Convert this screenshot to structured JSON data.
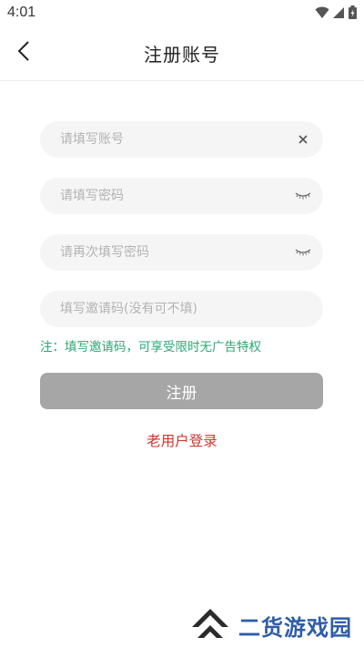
{
  "status_bar": {
    "time": "4:01"
  },
  "header": {
    "title": "注册账号"
  },
  "form": {
    "account": {
      "placeholder": "请填写账号",
      "value": ""
    },
    "password": {
      "placeholder": "请填写密码",
      "value": ""
    },
    "confirm_password": {
      "placeholder": "请再次填写密码",
      "value": ""
    },
    "invite_code": {
      "placeholder": "填写邀请码(没有可不填)",
      "value": ""
    }
  },
  "note": "注：填写邀请码，可享受限时无广告特权",
  "register_button": "注册",
  "login_link": "老用户登录",
  "watermark": {
    "text": "二货游戏园"
  },
  "colors": {
    "note": "#2aa876",
    "login_link": "#d0342c",
    "register_button_bg": "#a6a6a6",
    "field_bg": "#f5f5f5",
    "watermark": "#2e5da8"
  }
}
